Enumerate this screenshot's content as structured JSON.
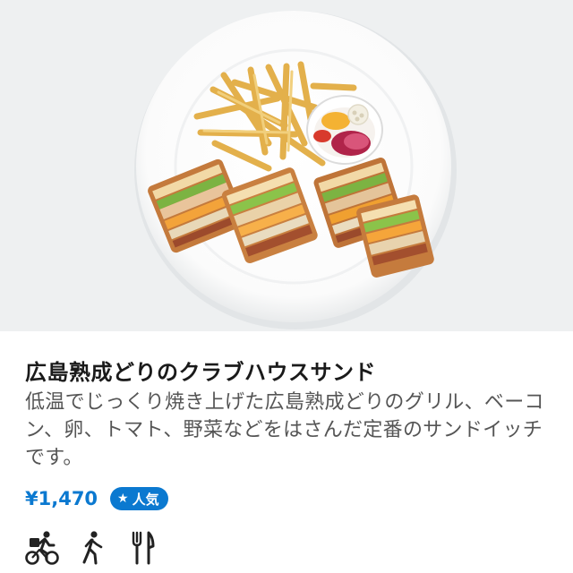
{
  "item": {
    "title": "広島熟成どりのクラブハウスサンド",
    "description": "低温でじっくり焼き上げた広島熟成どりのグリル、ベーコン、卵、トマト、野菜などをはさんだ定番のサンドイッチです。",
    "price": "¥1,470",
    "badge": {
      "star": "★",
      "label": "人気"
    }
  },
  "availability_icons": [
    "delivery-bicycle-icon",
    "takeout-walking-icon",
    "dine-in-fork-knife-icon"
  ],
  "colors": {
    "accent": "#0b79d0",
    "title": "#1a1a1a",
    "description": "#555555",
    "photo_background": "#eef0f1"
  }
}
